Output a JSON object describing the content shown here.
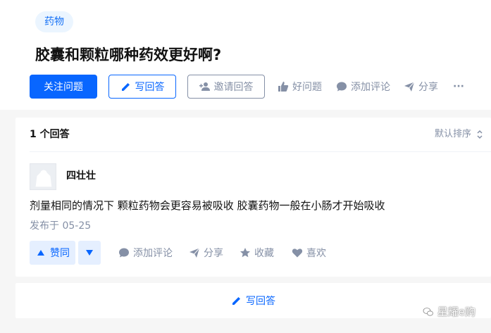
{
  "question": {
    "tag": "药物",
    "title": "胶囊和颗粒哪种药效更好啊?"
  },
  "toolbar": {
    "follow_label": "关注问题",
    "write_label": "写回答",
    "invite_label": "邀请回答",
    "good_question_label": "好问题",
    "add_comment_label": "添加评论",
    "share_label": "分享",
    "more_label": "···"
  },
  "answers": {
    "count_label": "1 个回答",
    "sort_label": "默认排序",
    "items": [
      {
        "author": "四壮壮",
        "content": "剂量相同的情况下 颗粒药物会更容易被吸收 胶囊药物一般在小肠才开始吸收",
        "published": "发布于 05-25",
        "vote_label": "赞同",
        "comment_label": "添加评论",
        "share_label": "分享",
        "collect_label": "收藏",
        "like_label": "喜欢"
      }
    ]
  },
  "write_bar_label": "写回答",
  "watermark": "星耀e购",
  "colors": {
    "primary": "#0866ff",
    "muted": "#8590a6",
    "tag_bg": "#ebf5ff",
    "vote_bg": "#e5efff"
  }
}
